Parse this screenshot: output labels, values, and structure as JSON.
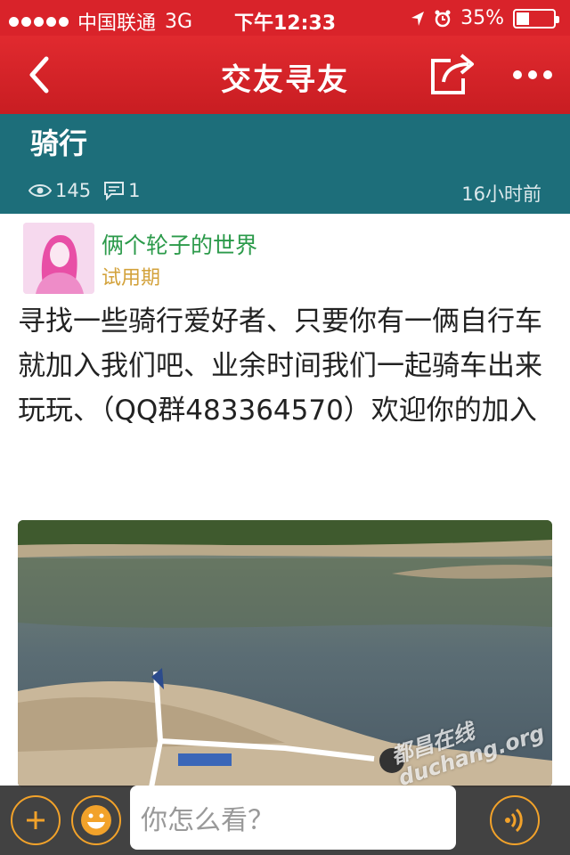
{
  "status_bar": {
    "carrier": "中国联通",
    "network": "3G",
    "time": "下午12:33",
    "battery_text": "35%",
    "battery_level": 0.35
  },
  "navbar": {
    "title": "交友寻友",
    "icons": [
      "back-chevron-icon",
      "share-icon",
      "more-icon"
    ]
  },
  "topic": {
    "title": "骑行",
    "views": "145",
    "comments": "1",
    "time_ago": "16小时前"
  },
  "post": {
    "author": "俩个轮子的世界",
    "level": "试用期",
    "body": "寻找一些骑行爱好者、只要你有一俩自行车就加入我们吧、业余时间我们一起骑车出来玩玩、（QQ群483364570）欢迎你的加入",
    "watermark_line1": "都昌在线",
    "watermark_line2": "duchang.org"
  },
  "bottom_bar": {
    "input_placeholder": "你怎么看？"
  },
  "colors": {
    "accent_red": "#d9232a",
    "topic_teal": "#1d6e7a",
    "author_green": "#2b9a4a",
    "level_gold": "#d3a23b",
    "button_orange": "#f2a22a"
  }
}
